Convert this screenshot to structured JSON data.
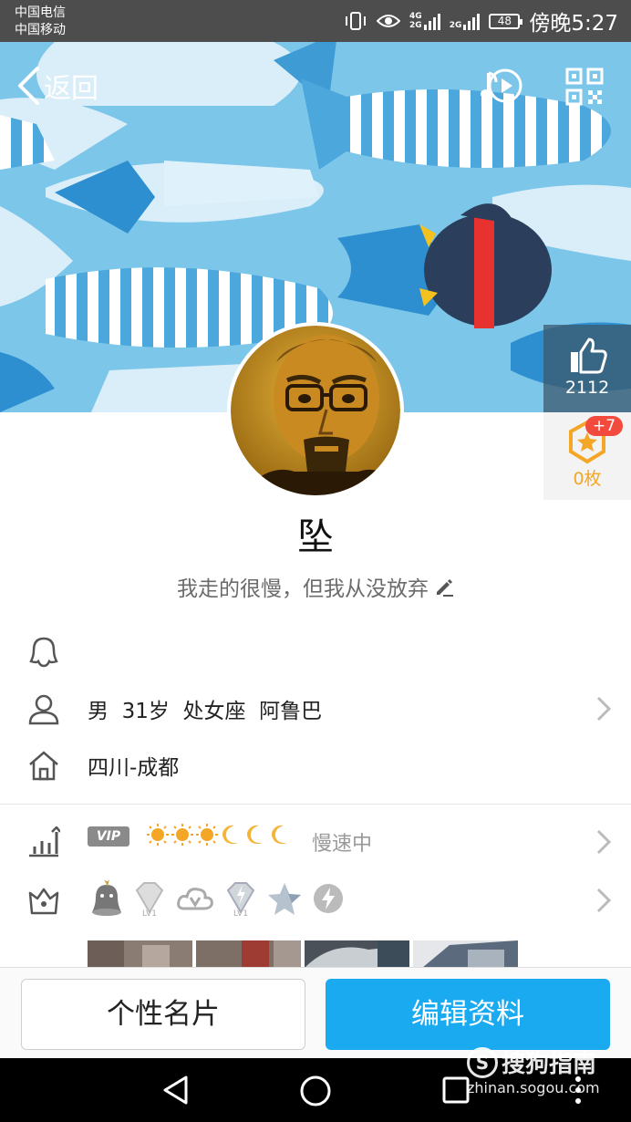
{
  "status_bar": {
    "carrier_1": "中国电信",
    "carrier_2": "中国移动",
    "network_1": "4G\n2G",
    "network_2": "2G",
    "battery": "48",
    "time": "傍晚5:27"
  },
  "nav": {
    "back_label": "返回"
  },
  "likes": {
    "count": "2112"
  },
  "badge": {
    "plus": "+7",
    "count": "0枚"
  },
  "profile": {
    "nickname": "坠",
    "signature": "我走的很慢，但我从没放弃"
  },
  "info": {
    "basic": "男  31岁  处女座  阿鲁巴",
    "location": "四川-成都"
  },
  "level": {
    "vip": "VIP",
    "speed": "慢速中"
  },
  "buttons": {
    "card": "个性名片",
    "edit": "编辑资料"
  },
  "watermark": {
    "title": "搜狗指南",
    "url": "zhinan.sogou.com"
  },
  "colors": {
    "accent": "#1aaaf0",
    "cover_bg": "#7cc6ea",
    "badge_red": "#f24a3d",
    "gold": "#f4a626"
  }
}
